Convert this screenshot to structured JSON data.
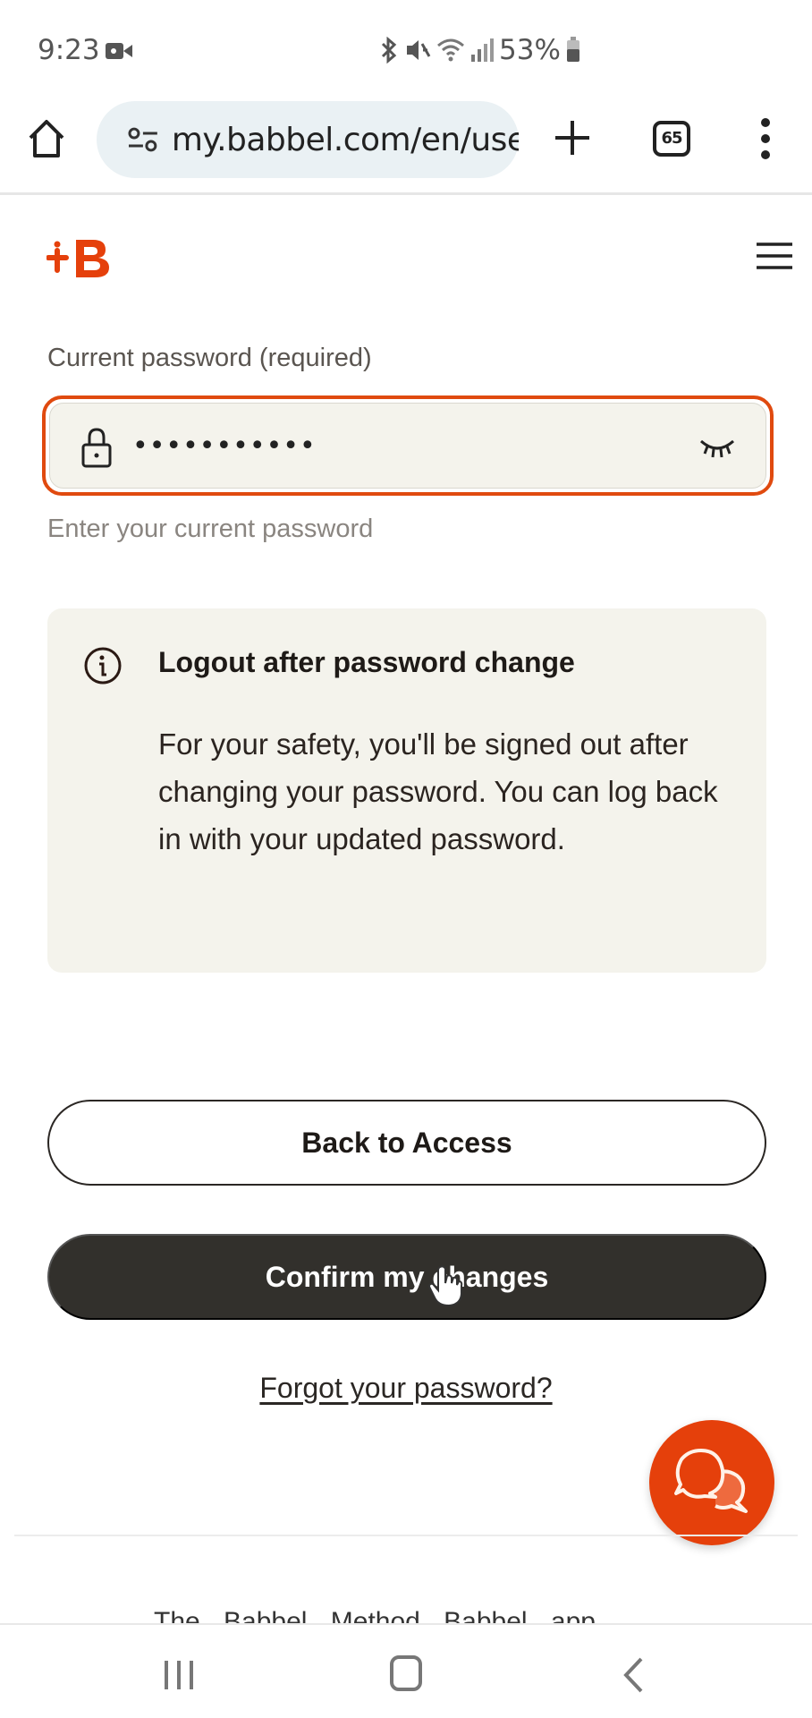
{
  "status_bar": {
    "time": "9:23",
    "battery": "53%",
    "icons": [
      "video-record-icon",
      "bluetooth-icon",
      "mute-vibrate-icon",
      "wifi-icon",
      "signal-icon",
      "battery-icon"
    ]
  },
  "browser": {
    "url": "my.babbel.com/en/user",
    "tab_count": "65",
    "icons": [
      "home-icon",
      "site-settings-icon",
      "new-tab-icon",
      "tabs-icon",
      "more-menu-icon"
    ]
  },
  "site": {
    "brand": "Babbel",
    "logo_text": "+B",
    "brand_color": "#e5400b"
  },
  "form": {
    "current_password": {
      "label": "Current password (required)",
      "value_masked": "•••••••••••",
      "helper": "Enter your current password",
      "state": "focused",
      "border_color": "#e04a0f"
    }
  },
  "notice": {
    "title": "Logout after password change",
    "body": "For your safety, you'll be signed out after changing your password. You can log back in with your updated password."
  },
  "actions": {
    "back_label": "Back to Access",
    "confirm_label": "Confirm my changes",
    "forgot_label": "Forgot your password?"
  },
  "footer": {
    "links_partial": "The Babbel Method   Babbel app"
  },
  "system_nav": {
    "buttons": [
      "recents",
      "home",
      "back"
    ]
  }
}
